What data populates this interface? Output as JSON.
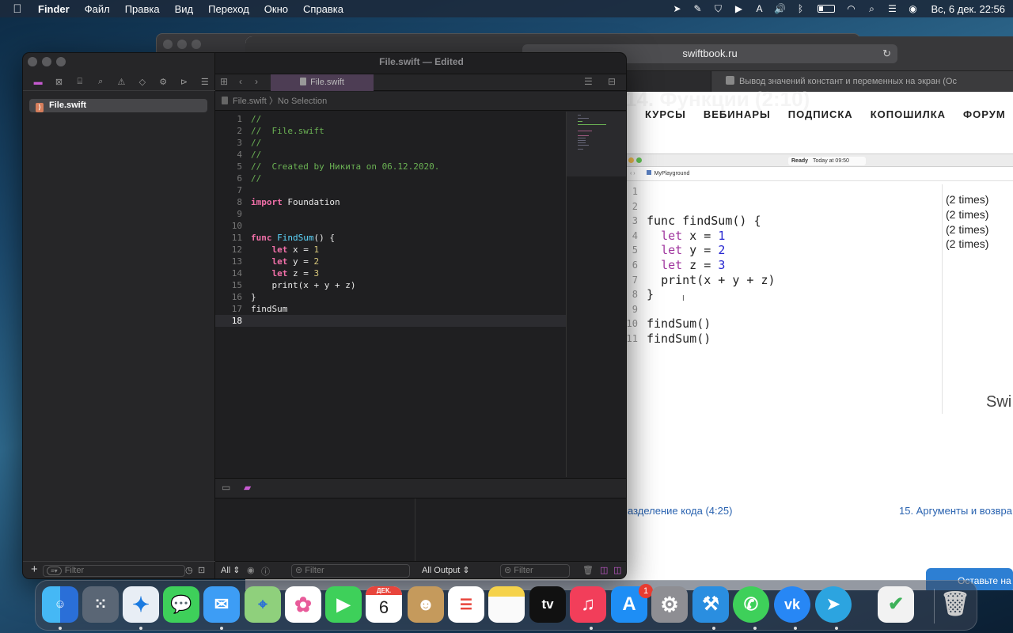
{
  "menubar": {
    "apple": "",
    "app": "Finder",
    "items": [
      "Файл",
      "Правка",
      "Вид",
      "Переход",
      "Окно",
      "Справка"
    ],
    "tray": {
      "a_icon": "A",
      "datetime": "Вс, 6 дек.  22:56"
    }
  },
  "safari": {
    "url": "swiftbook.ru",
    "tab_title": "Вывод значений констант и переменных на экран (Ос",
    "heading_ghost": "14. Функции (2:10)",
    "nav": [
      "КУРСЫ",
      "ВЕБИНАРЫ",
      "ПОДПИСКА",
      "КОПОШИЛКА",
      "ФОРУМ"
    ],
    "playground": {
      "status_ready": "Ready",
      "status_time": "Today at 09:50",
      "crumb": "MyPlayground",
      "line_numbers": [
        "1",
        "2",
        "3",
        "4",
        "5",
        "6",
        "7",
        "8",
        "9",
        "10",
        "11"
      ],
      "lines": [
        {
          "a": "",
          "k": "",
          "b": "",
          "nv": "",
          "c": ""
        },
        {
          "a": "",
          "k": "",
          "b": "",
          "nv": "",
          "c": ""
        },
        {
          "a": "func findSum() {",
          "k": "",
          "b": "",
          "nv": "",
          "c": ""
        },
        {
          "a": "  ",
          "k": "let",
          "b": " x = ",
          "nv": "1",
          "c": ""
        },
        {
          "a": "  ",
          "k": "let",
          "b": " y = ",
          "nv": "2",
          "c": ""
        },
        {
          "a": "  ",
          "k": "let",
          "b": " z = ",
          "nv": "3",
          "c": ""
        },
        {
          "a": "  ",
          "k": "",
          "b": "",
          "nv": "",
          "c": "print(x + y + z)"
        },
        {
          "a": "}",
          "k": "",
          "b": "",
          "nv": "",
          "c": ""
        },
        {
          "a": "",
          "k": "",
          "b": "",
          "nv": "",
          "c": ""
        },
        {
          "a": "findSum()",
          "k": "",
          "b": "",
          "nv": "",
          "c": ""
        },
        {
          "a": "findSum()",
          "k": "",
          "b": "",
          "nv": "",
          "c": ""
        }
      ],
      "results": [
        "(2 times)",
        "(2 times)",
        "(2 times)",
        "(2 times)"
      ],
      "watermark": "Swi"
    },
    "link_prev": "азделение кода (4:25)",
    "link_next": "15. Аргументы и возвра",
    "feedback": "Оставьте на"
  },
  "xcode": {
    "title": "File.swift — Edited",
    "tab": "File.swift",
    "nav_file": "File.swift",
    "jump_file": "File.swift",
    "jump_sel": "No Selection",
    "nav_filter": "Filter",
    "var_scope": "All",
    "var_filter": "Filter",
    "out_scope": "All Output",
    "out_filter": "Filter",
    "lines": [
      {
        "n": "1",
        "cm": "//",
        "kw": "",
        "fn": "",
        "t": "",
        "num": "",
        "t2": ""
      },
      {
        "n": "2",
        "cm": "//  File.swift",
        "kw": "",
        "fn": "",
        "t": "",
        "num": "",
        "t2": ""
      },
      {
        "n": "3",
        "cm": "//",
        "kw": "",
        "fn": "",
        "t": "",
        "num": "",
        "t2": ""
      },
      {
        "n": "4",
        "cm": "//",
        "kw": "",
        "fn": "",
        "t": "",
        "num": "",
        "t2": ""
      },
      {
        "n": "5",
        "cm": "//  Created by Никита on 06.12.2020.",
        "kw": "",
        "fn": "",
        "t": "",
        "num": "",
        "t2": ""
      },
      {
        "n": "6",
        "cm": "//",
        "kw": "",
        "fn": "",
        "t": "",
        "num": "",
        "t2": ""
      },
      {
        "n": "7",
        "cm": "",
        "kw": "",
        "fn": "",
        "t": "",
        "num": "",
        "t2": ""
      },
      {
        "n": "8",
        "cm": "",
        "kw": "import",
        "fn": "",
        "t": " Foundation",
        "num": "",
        "t2": ""
      },
      {
        "n": "9",
        "cm": "",
        "kw": "",
        "fn": "",
        "t": "",
        "num": "",
        "t2": ""
      },
      {
        "n": "10",
        "cm": "",
        "kw": "",
        "fn": "",
        "t": "",
        "num": "",
        "t2": ""
      },
      {
        "n": "11",
        "cm": "",
        "kw": "func",
        "fn": " FindSum",
        "t": "() {",
        "num": "",
        "t2": ""
      },
      {
        "n": "12",
        "cm": "",
        "kw": "    let",
        "fn": "",
        "t": " x = ",
        "num": "1",
        "t2": ""
      },
      {
        "n": "13",
        "cm": "",
        "kw": "    let",
        "fn": "",
        "t": " y = ",
        "num": "2",
        "t2": ""
      },
      {
        "n": "14",
        "cm": "",
        "kw": "    let",
        "fn": "",
        "t": " z = ",
        "num": "3",
        "t2": ""
      },
      {
        "n": "15",
        "cm": "",
        "kw": "",
        "fn": "",
        "t": "    print(x + y + z)",
        "num": "",
        "t2": ""
      },
      {
        "n": "16",
        "cm": "",
        "kw": "",
        "fn": "",
        "t": "}",
        "num": "",
        "t2": ""
      },
      {
        "n": "17",
        "cm": "",
        "kw": "",
        "fn": "",
        "t": "findSum",
        "num": "",
        "t2": ""
      },
      {
        "n": "18",
        "cm": "",
        "kw": "",
        "fn": "",
        "t": "",
        "num": "",
        "t2": ""
      }
    ]
  },
  "dock": {
    "calendar_month": "ДЕК.",
    "calendar_day": "6",
    "tv": "tv",
    "appstore_badge": "1",
    "apps": [
      "Finder",
      "Launchpad",
      "Safari",
      "Messages",
      "Mail",
      "Maps",
      "Photos",
      "FaceTime",
      "Calendar",
      "Contacts",
      "Reminders",
      "Notes",
      "TV",
      "Music",
      "App Store",
      "System Preferences",
      "Xcode",
      "WhatsApp",
      "VK",
      "Telegram",
      "AdGuard",
      "Trash"
    ]
  },
  "colors": {
    "accent_xcode": "#c65ad0",
    "keyword": "#f06fa8",
    "comment": "#6bb254",
    "number": "#d9c97c",
    "link": "#2a63b0"
  }
}
